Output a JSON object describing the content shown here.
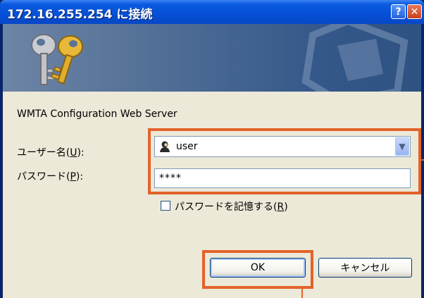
{
  "window": {
    "title": "172.16.255.254 に接続",
    "help_glyph": "?",
    "close_glyph": "✕"
  },
  "banner": {
    "icon": "keys-icon"
  },
  "dialog": {
    "server_text": "WMTA Configuration Web Server",
    "username": {
      "label_prefix": "ユーザー名(",
      "label_key": "U",
      "label_suffix": "):",
      "value": "user",
      "icon": "user-icon"
    },
    "password": {
      "label_prefix": "パスワード(",
      "label_key": "P",
      "label_suffix": "):",
      "value": "****"
    },
    "remember": {
      "label_prefix": "パスワードを記憶する(",
      "label_key": "R",
      "label_suffix": ")",
      "checked": false
    },
    "ok_label": "OK",
    "cancel_label": "キャンセル"
  },
  "colors": {
    "highlight": "#e2632a",
    "title_bar": "#0550d6",
    "dialog_bg": "#ece9d8"
  }
}
